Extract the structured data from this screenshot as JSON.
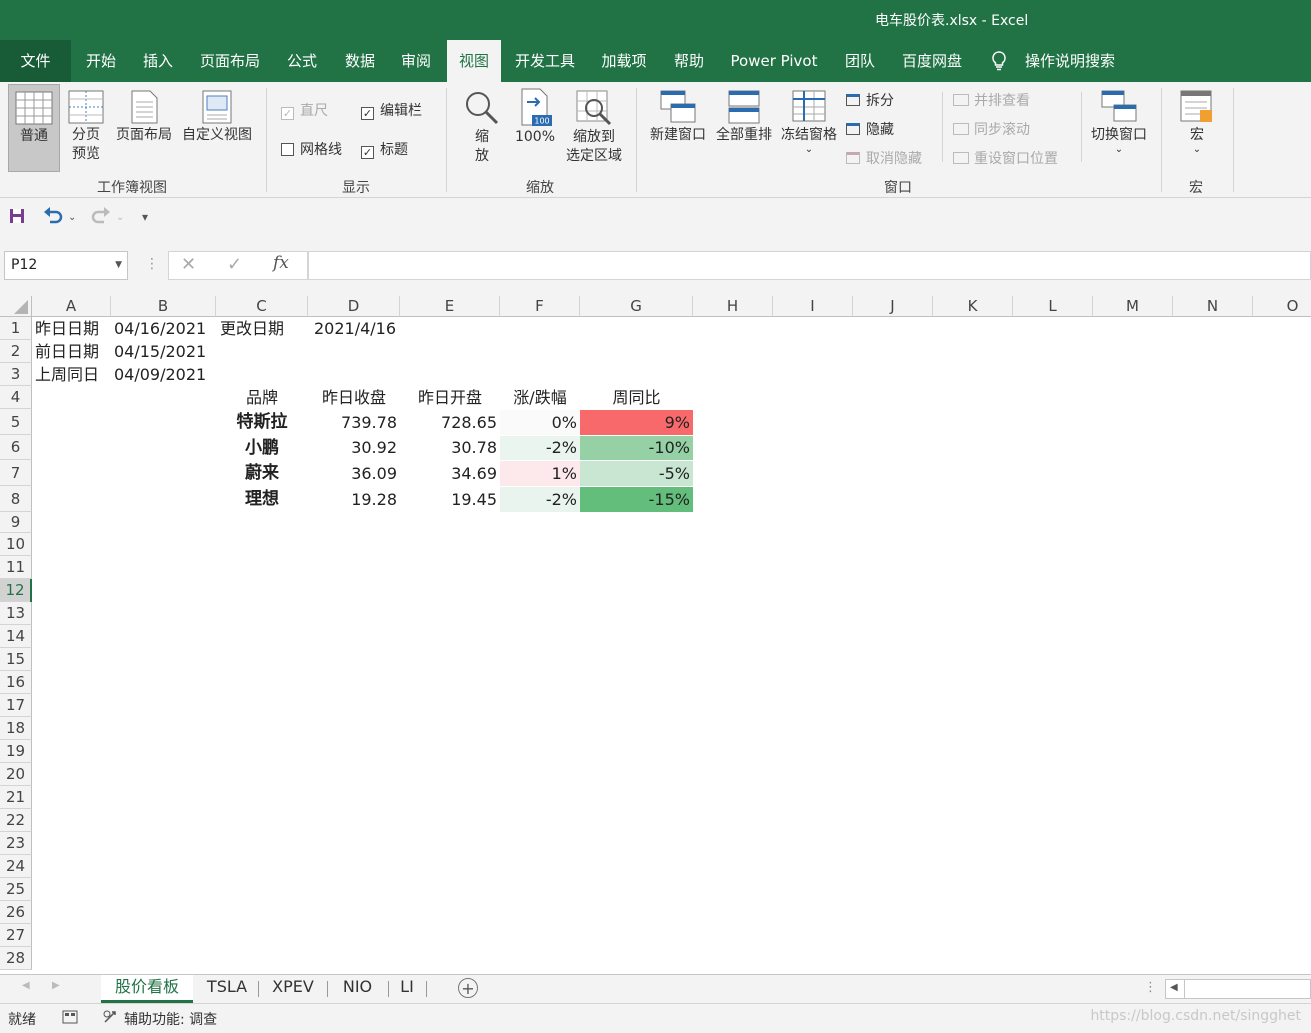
{
  "window": {
    "title": "电车股价表.xlsx  -  Excel"
  },
  "ribbon_tabs": [
    "文件",
    "开始",
    "插入",
    "页面布局",
    "公式",
    "数据",
    "审阅",
    "视图",
    "开发工具",
    "加载项",
    "帮助",
    "Power Pivot",
    "团队",
    "百度网盘",
    "操作说明搜索"
  ],
  "active_tab": "视图",
  "ribbon": {
    "workbook_views": {
      "label": "工作簿视图",
      "normal": "普通",
      "page_break_l1": "分页",
      "page_break_l2": "预览",
      "page_layout": "页面布局",
      "custom_views": "自定义视图"
    },
    "show": {
      "label": "显示",
      "ruler": "直尺",
      "formula_bar": "编辑栏",
      "gridlines": "网格线",
      "headings": "标题",
      "ruler_checked": true,
      "formula_bar_checked": true,
      "gridlines_checked": false,
      "headings_checked": true
    },
    "zoom": {
      "label": "缩放",
      "zoom_l1": "缩",
      "zoom_l2": "放",
      "zoom100": "100%",
      "zoom100_icon_text": "100",
      "zoom_sel_l1": "缩放到",
      "zoom_sel_l2": "选定区域"
    },
    "window": {
      "label": "窗口",
      "new_window": "新建窗口",
      "arrange_all": "全部重排",
      "freeze_panes": "冻结窗格",
      "split": "拆分",
      "hide": "隐藏",
      "unhide": "取消隐藏",
      "side_by_side": "并排查看",
      "sync_scroll": "同步滚动",
      "reset_pos": "重设窗口位置",
      "switch_windows": "切换窗口"
    },
    "macros": {
      "label": "宏",
      "macros": "宏"
    }
  },
  "name_box": {
    "value": "P12"
  },
  "formula_bar": {
    "fx": "fx",
    "value": ""
  },
  "columns": [
    "A",
    "B",
    "C",
    "D",
    "E",
    "F",
    "G",
    "H",
    "I",
    "J",
    "K",
    "L",
    "M",
    "N",
    "O"
  ],
  "rows": [
    "1",
    "2",
    "3",
    "4",
    "5",
    "6",
    "7",
    "8",
    "9",
    "10",
    "11",
    "12",
    "13",
    "14",
    "15",
    "16",
    "17",
    "18",
    "19",
    "20",
    "21",
    "22",
    "23",
    "24",
    "25",
    "26",
    "27",
    "28"
  ],
  "selected_row": "12",
  "cells": {
    "A1": "昨日日期",
    "B1": "04/16/2021",
    "C1": "更改日期",
    "D1": "2021/4/16",
    "A2": "前日日期",
    "B2": "04/15/2021",
    "A3": "上周同日",
    "B3": "04/09/2021",
    "C4": "品牌",
    "D4": "昨日收盘",
    "E4": "昨日开盘",
    "F4": "涨/跌幅",
    "G4": "周同比",
    "C5": "特斯拉",
    "D5": "739.78",
    "E5": "728.65",
    "F5": "0%",
    "G5": "9%",
    "C6": "小鹏",
    "D6": "30.92",
    "E6": "30.78",
    "F6": "-2%",
    "G6": "-10%",
    "C7": "蔚来",
    "D7": "36.09",
    "E7": "34.69",
    "F7": "1%",
    "G7": "-5%",
    "C8": "理想",
    "D8": "19.28",
    "E8": "19.45",
    "F8": "-2%",
    "G8": "-15%"
  },
  "cell_fills": {
    "F5": "#fafafa",
    "G5": "#f8696b",
    "F6": "#ebf5ef",
    "G6": "#96d1a6",
    "F7": "#fde9ec",
    "G7": "#c8e6d1",
    "F8": "#e9f4ee",
    "G8": "#63be7b"
  },
  "sheet_tabs": [
    "股价看板",
    "TSLA",
    "XPEV",
    "NIO",
    "LI"
  ],
  "active_sheet": "股价看板",
  "status": {
    "ready": "就绪",
    "accessibility": "辅助功能: 调查"
  },
  "watermark": "https://blog.csdn.net/singghet"
}
